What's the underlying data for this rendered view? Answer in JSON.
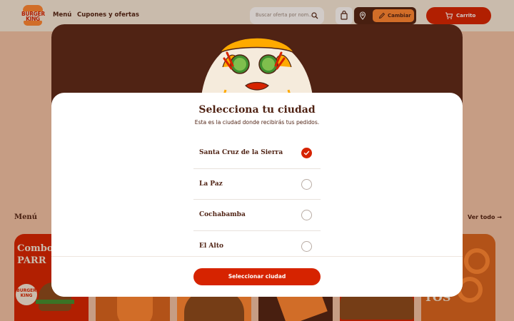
{
  "header": {
    "logo_top": "BURGER",
    "logo_bottom": "KING",
    "nav": [
      "Menú",
      "Cupones y ofertas"
    ],
    "search_placeholder": "Buscar oferta por nom...",
    "change_label": "Cambiar",
    "cart_label": "Carrito"
  },
  "menu_section": {
    "title": "Menú",
    "see_all": "Ver todo",
    "card_texts": [
      "Combos",
      "PARR",
      "BURGER",
      "KING",
      "TOS"
    ]
  },
  "modal": {
    "title": "Selecciona tu ciudad",
    "subtitle": "Esta es la ciudad donde recibirás tus pedidos.",
    "cities": [
      {
        "name": "Santa Cruz de la Sierra",
        "selected": true
      },
      {
        "name": "La Paz",
        "selected": false
      },
      {
        "name": "Cochabamba",
        "selected": false
      },
      {
        "name": "El Alto",
        "selected": false
      }
    ],
    "button_label": "Seleccionar ciudad"
  },
  "colors": {
    "brand_red": "#d62300",
    "brand_brown": "#502314",
    "brand_orange": "#ff8732",
    "cream": "#f5ebdc"
  }
}
